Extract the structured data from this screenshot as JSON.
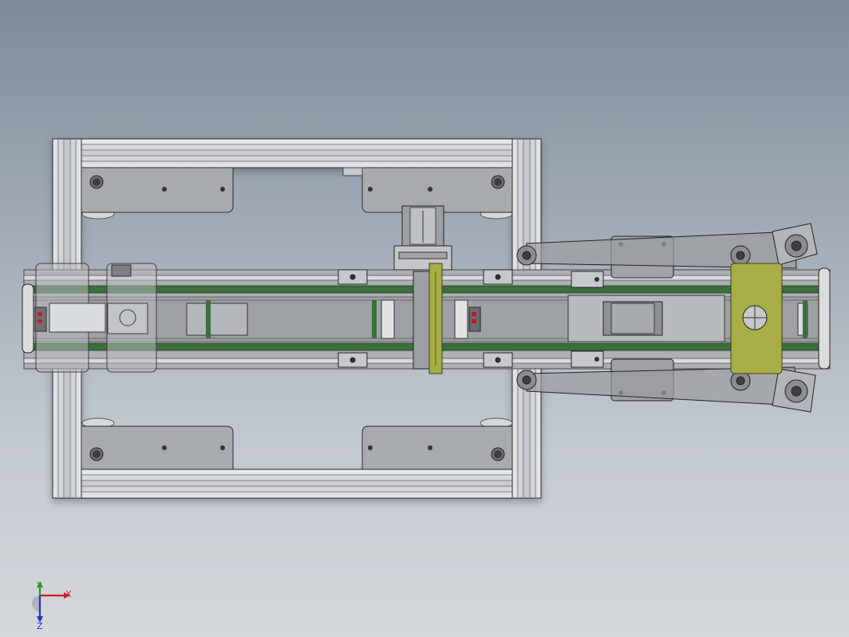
{
  "viewport": {
    "background_top": "#7f8b9a",
    "background_bottom": "#d4d8dc"
  },
  "colors": {
    "frame": "#d5d8db",
    "frame_dark": "#8e9296",
    "plate": "#a7aaad",
    "belt": "#3d6e3d",
    "bracket": "#a8ad46",
    "edge": "#2b2b2b"
  },
  "triad": {
    "x_label": "X",
    "y_label": "Y",
    "z_label": "Z",
    "x_color": "#d01c1c",
    "y_color": "#1c9c2a",
    "z_color": "#2233cc"
  }
}
